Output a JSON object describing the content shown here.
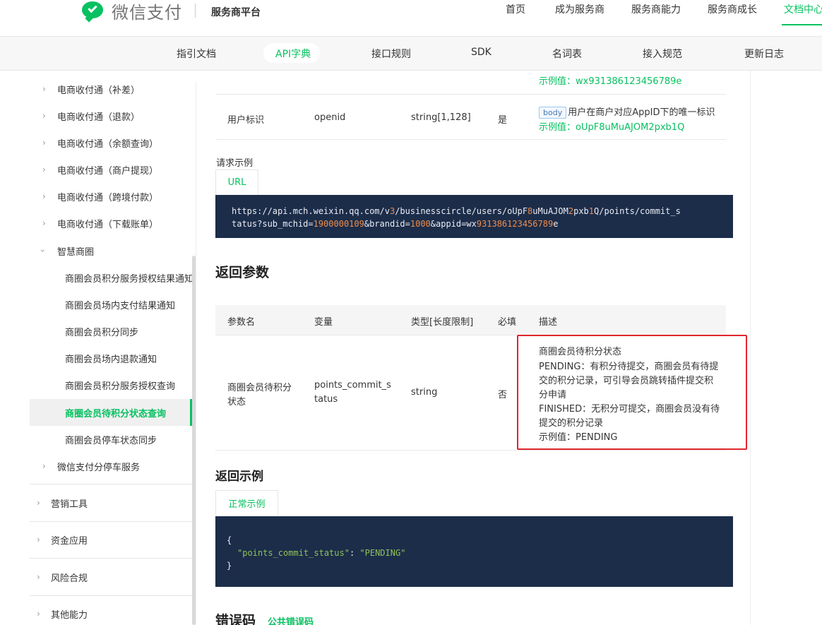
{
  "header": {
    "brand": "微信支付",
    "platform": "服务商平台",
    "nav": [
      "首页",
      "成为服务商",
      "服务商能力",
      "服务商成长",
      "文档中心"
    ],
    "active_nav": "文档中心"
  },
  "subnav": {
    "items": [
      "指引文档",
      "API字典",
      "接口规则",
      "SDK",
      "名词表",
      "接入规范",
      "更新日志"
    ],
    "active": "API字典"
  },
  "sidebar": {
    "items": [
      "电商收付通（补差）",
      "电商收付通（退款）",
      "电商收付通（余额查询）",
      "电商收付通（商户提现）",
      "电商收付通（跨境付款）",
      "电商收付通（下载账单）",
      "智慧商圈",
      "商圈会员积分服务授权结果通知",
      "商圈会员场内支付结果通知",
      "商圈会员积分同步",
      "商圈会员场内退款通知",
      "商圈会员积分服务授权查询",
      "商圈会员待积分状态查询",
      "商圈会员停车状态同步",
      "微信支付分停车服务"
    ],
    "groups": [
      "营销工具",
      "资金应用",
      "风险合规",
      "其他能力"
    ]
  },
  "request_table": {
    "prev_example": "示例值：wx931386123456789e",
    "row": {
      "name": "用户标识",
      "variable": "openid",
      "type": "string[1,128]",
      "required": "是",
      "tag": "body",
      "desc": "用户在商户对应AppID下的唯一标识",
      "example": "示例值：oUpF8uMuAJOM2pxb1Q"
    }
  },
  "request_example": {
    "label": "请求示例",
    "tab": "URL",
    "line1_a": "https://api.mch.weixin.qq.com/v",
    "line1_n1": "3",
    "line1_b": "/businesscircle/users/oUpF",
    "line1_n2": "8",
    "line1_c": "uMuAJOM",
    "line1_n3": "2",
    "line1_d": "pxb",
    "line1_n4": "1",
    "line1_e": "Q/points/commit_s",
    "line2_a": "tatus?sub_mchid=",
    "line2_n1": "1900000109",
    "line2_b": "&brandid=",
    "line2_n2": "1000",
    "line2_c": "&appid=wx",
    "line2_n3": "931386123456789",
    "line2_d": "e"
  },
  "response_params": {
    "title": "返回参数",
    "headers": [
      "参数名",
      "变量",
      "类型[长度限制]",
      "必填",
      "描述"
    ],
    "row": {
      "name_1": "商圈会员待积分",
      "name_2": "状态",
      "variable_1": "points_commit_s",
      "variable_2": "tatus",
      "type": "string",
      "required": "否",
      "desc": [
        "商圈会员待积分状态",
        "PENDING：有积分待提交，商圈会员有待提",
        "交的积分记录，可引导会员跳转插件提交积",
        "分申请",
        "FINISHED：无积分可提交，商圈会员没有待",
        "提交的积分记录"
      ],
      "example": "示例值：PENDING"
    }
  },
  "response_example": {
    "title": "返回示例",
    "tab": "正常示例",
    "open": "{",
    "key": "\"points_commit_status\"",
    "colon": ": ",
    "value": "\"PENDING\"",
    "close": "}"
  },
  "error_codes": {
    "title": "错误码",
    "link": "公共错误码"
  }
}
